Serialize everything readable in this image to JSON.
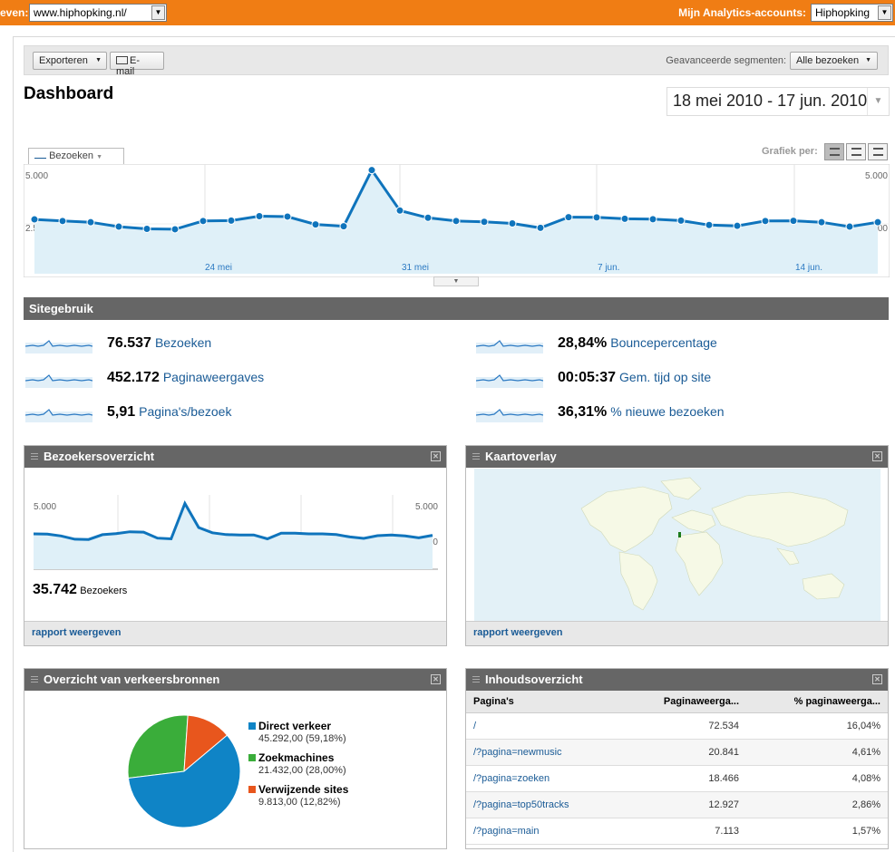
{
  "topbar": {
    "left_label": "even:",
    "site_value": "www.hiphopking.nl/",
    "right_label": "Mijn Analytics-accounts:",
    "account_value": "Hiphopking"
  },
  "toolbar": {
    "export_label": "Exporteren",
    "email_label": "E-mail",
    "segments_label": "Geavanceerde segmenten:",
    "segments_value": "Alle bezoeken"
  },
  "page_title": "Dashboard",
  "date_range": "18 mei 2010 - 17 jun. 2010",
  "main_chart": {
    "tab_label": "Bezoeken",
    "grafiek_label": "Grafiek per:",
    "y_top": "5.000",
    "y_mid": "2.500",
    "x_labels": [
      "24 mei",
      "31 mei",
      "7 jun.",
      "14 jun."
    ],
    "ymax": 5000,
    "values": [
      2700,
      2620,
      2560,
      2340,
      2230,
      2210,
      2620,
      2640,
      2860,
      2840,
      2450,
      2360,
      5150,
      3140,
      2780,
      2620,
      2580,
      2500,
      2280,
      2810,
      2800,
      2730,
      2710,
      2640,
      2420,
      2380,
      2620,
      2630,
      2560,
      2340,
      2560
    ],
    "color": "#0f74bc"
  },
  "site_usage": {
    "title": "Sitegebruik",
    "metrics": [
      {
        "value": "76.537",
        "label": "Bezoeken"
      },
      {
        "value": "28,84%",
        "label": "Bouncepercentage"
      },
      {
        "value": "452.172",
        "label": "Paginaweergaves"
      },
      {
        "value": "00:05:37",
        "label": "Gem. tijd op site"
      },
      {
        "value": "5,91",
        "label": "Pagina's/bezoek"
      },
      {
        "value": "36,31%",
        "label": "% nieuwe bezoeken"
      }
    ]
  },
  "visitors_widget": {
    "title": "Bezoekersoverzicht",
    "y_top": "5.000",
    "y_mid": "2.500",
    "values": [
      2500,
      2480,
      2350,
      2120,
      2100,
      2440,
      2520,
      2650,
      2620,
      2200,
      2150,
      4650,
      2950,
      2580,
      2450,
      2420,
      2420,
      2150,
      2550,
      2550,
      2500,
      2500,
      2450,
      2280,
      2180,
      2370,
      2420,
      2350,
      2220,
      2400
    ],
    "ymax": 5000,
    "big_value": "35.742",
    "big_label": "Bezoekers",
    "footer_link": "rapport weergeven"
  },
  "map_widget": {
    "title": "Kaartoverlay",
    "footer_link": "rapport weergeven"
  },
  "traffic_widget": {
    "title": "Overzicht van verkeersbronnen",
    "slices": [
      {
        "name": "Direct verkeer",
        "value": "45.292,00 (59,18%)",
        "pct": 59.18,
        "color": "#0f84c6"
      },
      {
        "name": "Zoekmachines",
        "value": "21.432,00 (28,00%)",
        "pct": 28.0,
        "color": "#3aad3a"
      },
      {
        "name": "Verwijzende sites",
        "value": "9.813,00 (12,82%)",
        "pct": 12.82,
        "color": "#e8561d"
      }
    ]
  },
  "content_widget": {
    "title": "Inhoudsoverzicht",
    "columns": [
      "Pagina's",
      "Paginaweerga...",
      "% paginaweerga..."
    ],
    "rows": [
      {
        "page": "/",
        "views": "72.534",
        "pct": "16,04%"
      },
      {
        "page": "/?pagina=newmusic",
        "views": "20.841",
        "pct": "4,61%"
      },
      {
        "page": "/?pagina=zoeken",
        "views": "18.466",
        "pct": "4,08%"
      },
      {
        "page": "/?pagina=top50tracks",
        "views": "12.927",
        "pct": "2,86%"
      },
      {
        "page": "/?pagina=main",
        "views": "7.113",
        "pct": "1,57%"
      }
    ]
  }
}
